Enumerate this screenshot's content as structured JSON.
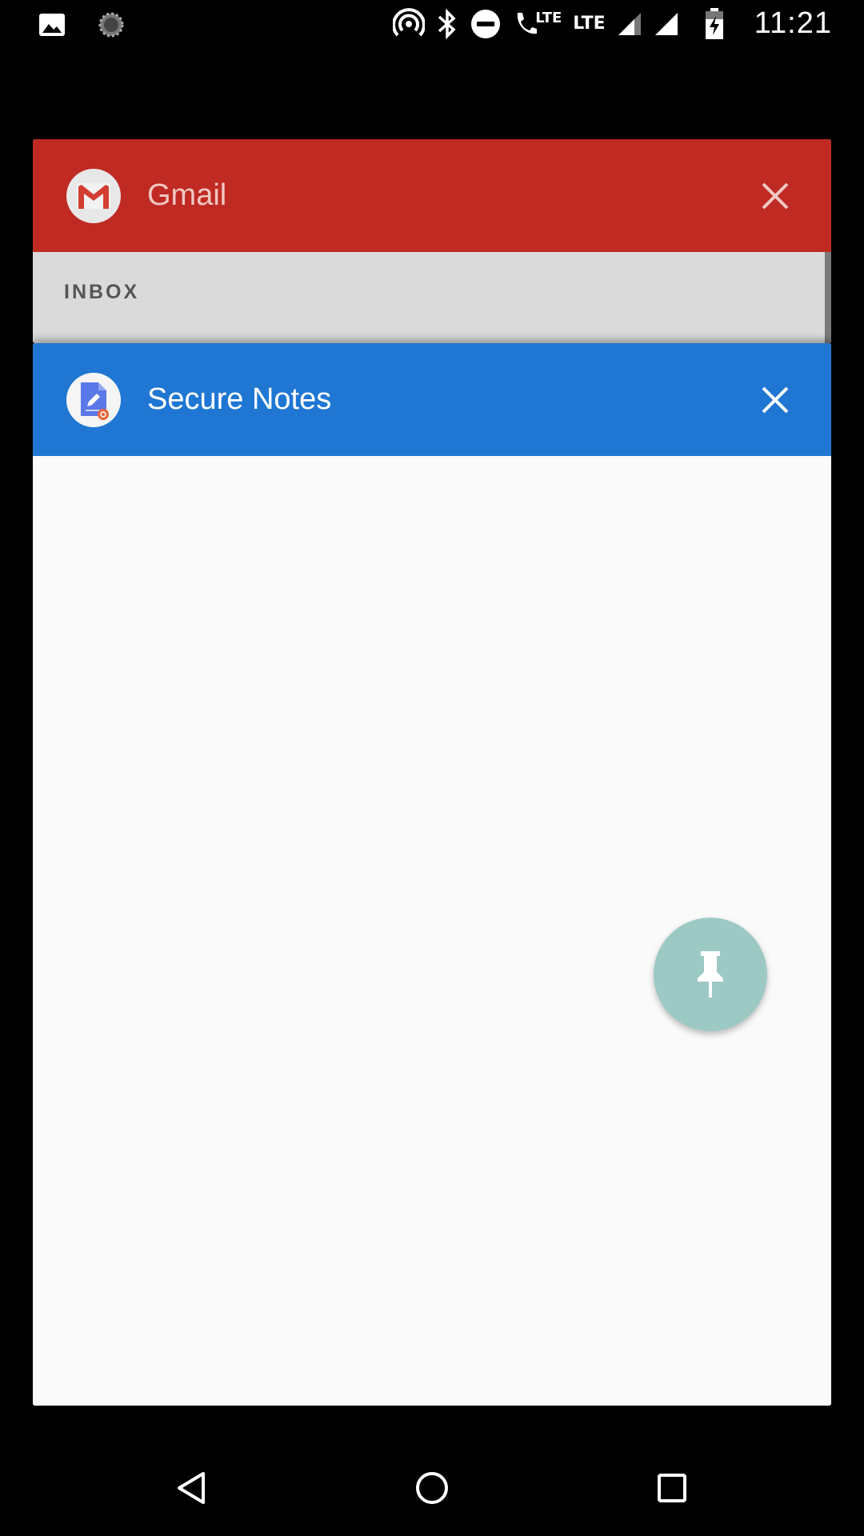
{
  "status_bar": {
    "time": "11:21",
    "lte_1": "LTE",
    "lte_2": "LTE",
    "left_icons": [
      "image-icon",
      "sync-spinner-icon"
    ],
    "right_icons": [
      "hotspot-icon",
      "bluetooth-icon",
      "do-not-disturb-icon",
      "volte-call-icon",
      "signal-icon",
      "signal-icon",
      "battery-charging-icon"
    ]
  },
  "cards": {
    "gmail": {
      "title": "Gmail",
      "section_label": "INBOX",
      "header_color": "#bf2a22"
    },
    "notes": {
      "title": "Secure Notes",
      "header_color": "#1f77d3"
    }
  },
  "fab": {
    "icon": "pin-icon",
    "color": "#9dc9c5"
  },
  "nav_bar": {
    "buttons": [
      "back-icon",
      "home-icon",
      "recents-icon"
    ]
  }
}
